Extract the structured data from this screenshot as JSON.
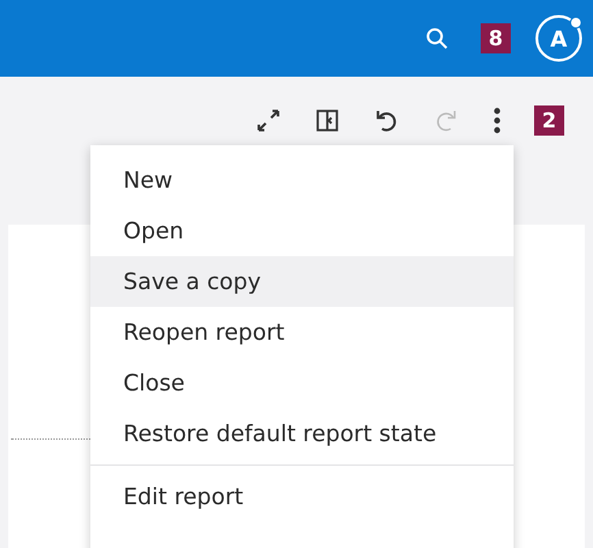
{
  "top_bar": {
    "notification_badge": "8",
    "avatar_initial": "A"
  },
  "toolbar": {
    "buttons": [
      {
        "kind": "expand",
        "disabled": false
      },
      {
        "kind": "panel",
        "disabled": false
      },
      {
        "kind": "undo",
        "disabled": false
      },
      {
        "kind": "redo",
        "disabled": true
      },
      {
        "kind": "more",
        "disabled": false
      }
    ],
    "badge": "2"
  },
  "menu": {
    "groups": [
      [
        {
          "label": "New",
          "selected": false
        },
        {
          "label": "Open",
          "selected": false
        },
        {
          "label": "Save a copy",
          "selected": true
        },
        {
          "label": "Reopen report",
          "selected": false
        },
        {
          "label": "Close",
          "selected": false
        },
        {
          "label": "Restore default report state",
          "selected": false
        }
      ],
      [
        {
          "label": "Edit report",
          "selected": false
        }
      ]
    ]
  }
}
